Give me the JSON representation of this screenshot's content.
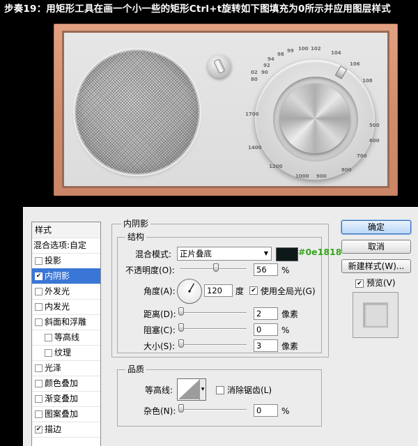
{
  "step_title": "步奏19：用矩形工具在画一个小一些的矩形Ctrl+t旋转如下图填充为0所示并应用图层样式",
  "dial_scale": [
    "90",
    "92",
    "94",
    "98",
    "99",
    "100",
    "102",
    "104",
    "106",
    "108",
    "80",
    "02",
    "1700",
    "1400",
    "1200",
    "1000",
    "900",
    "800",
    "700",
    "600",
    "500"
  ],
  "styles_panel": {
    "title": "样式",
    "items": [
      {
        "label": "混合选项:自定",
        "checked": null,
        "selected": false
      },
      {
        "label": "投影",
        "checked": false,
        "selected": false
      },
      {
        "label": "内阴影",
        "checked": true,
        "selected": true
      },
      {
        "label": "外发光",
        "checked": false,
        "selected": false
      },
      {
        "label": "内发光",
        "checked": false,
        "selected": false
      },
      {
        "label": "斜面和浮雕",
        "checked": false,
        "selected": false
      },
      {
        "label": "等高线",
        "checked": false,
        "selected": false
      },
      {
        "label": "纹理",
        "checked": false,
        "selected": false
      },
      {
        "label": "光泽",
        "checked": false,
        "selected": false
      },
      {
        "label": "颜色叠加",
        "checked": false,
        "selected": false
      },
      {
        "label": "渐变叠加",
        "checked": false,
        "selected": false
      },
      {
        "label": "图案叠加",
        "checked": false,
        "selected": false
      },
      {
        "label": "描边",
        "checked": true,
        "selected": false
      }
    ]
  },
  "inner_shadow": {
    "section_title": "内阴影",
    "structure_title": "结构",
    "blend_mode_label": "混合模式:",
    "blend_mode_value": "正片叠底",
    "color_hex_annotation": "#0e1818",
    "shadow_color": "#0e1818",
    "opacity_label": "不透明度(O):",
    "opacity_value": "56",
    "opacity_fraction": 0.56,
    "opacity_unit": "%",
    "angle_label": "角度(A):",
    "angle_value": "120",
    "angle_degrees": 120,
    "angle_unit": "度",
    "use_global_light_label": "使用全局光(G)",
    "use_global_light_checked": true,
    "distance_label": "距离(D):",
    "distance_value": "2",
    "distance_fraction": 0.0,
    "distance_unit": "像素",
    "choke_label": "阻塞(C):",
    "choke_value": "0",
    "choke_fraction": 0.0,
    "choke_unit": "%",
    "size_label": "大小(S):",
    "size_value": "3",
    "size_fraction": 0.0,
    "size_unit": "像素"
  },
  "quality": {
    "title": "品质",
    "contour_label": "等高线:",
    "anti_alias_label": "消除锯齿(L)",
    "anti_alias_checked": false,
    "noise_label": "杂色(N):",
    "noise_value": "0",
    "noise_fraction": 0.0,
    "noise_unit": "%"
  },
  "buttons": {
    "ok": "确定",
    "cancel": "取消",
    "new_style": "新建样式(W)...",
    "preview_label": "预览(V)",
    "preview_checked": true
  }
}
